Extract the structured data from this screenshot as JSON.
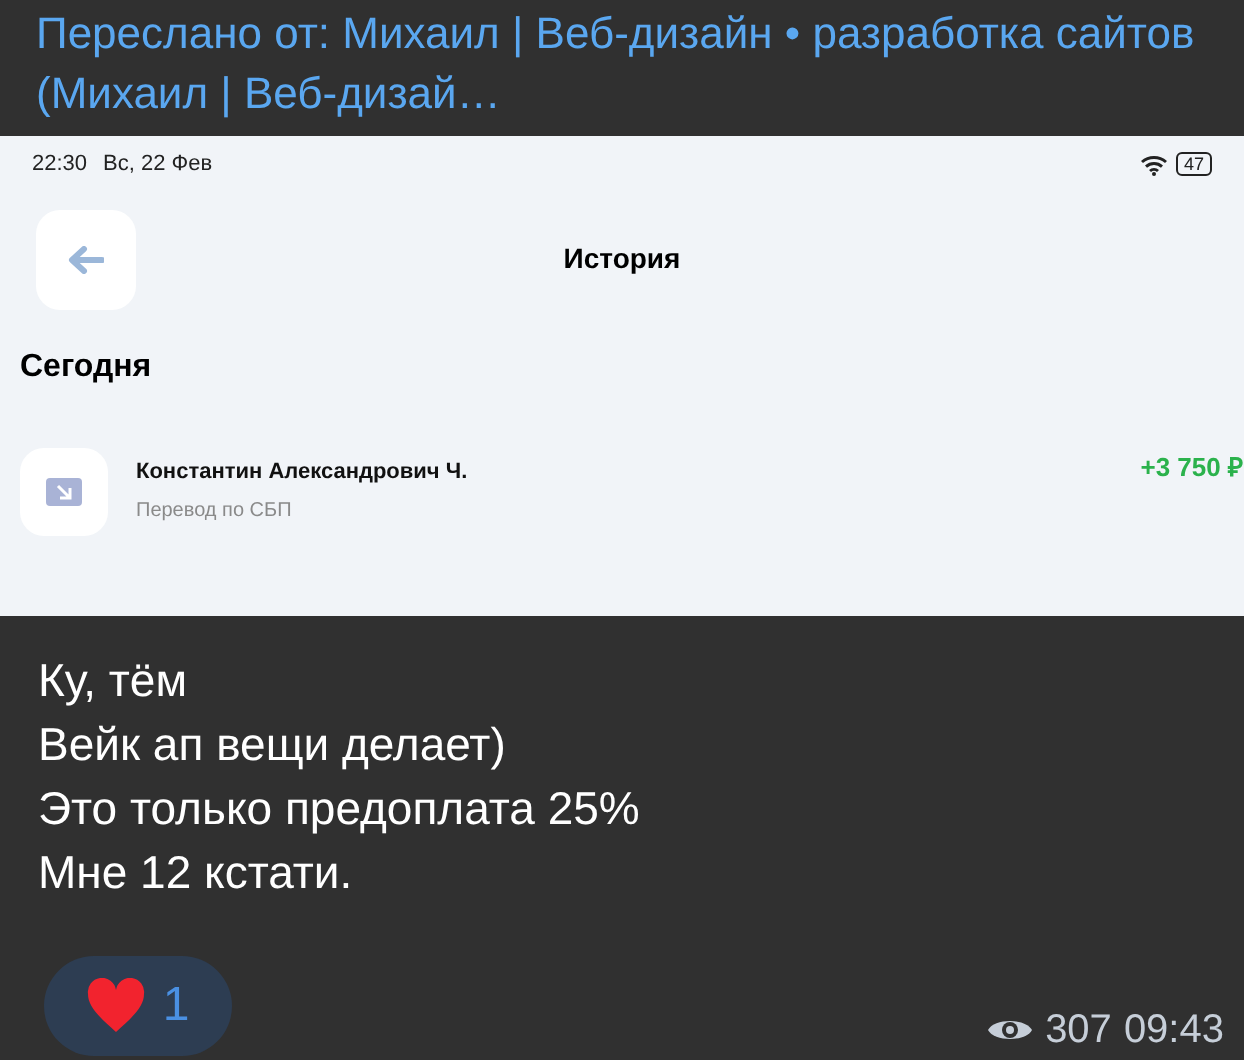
{
  "forwarded_from": {
    "label": "Переслано от: Михаил | Веб-дизайн • разработка сайтов (Михаил | Веб-дизай…"
  },
  "screenshot": {
    "status_bar": {
      "time": "22:30",
      "date": "Вс, 22 Фев",
      "battery": "47"
    },
    "title": "История",
    "section": "Сегодня",
    "transactions": [
      {
        "name": "Константин Александрович Ч.",
        "description": "Перевод по СБП",
        "amount": "+3 750 ₽"
      }
    ]
  },
  "message": {
    "lines": [
      "Ку, тём",
      "Вейк ап вещи делает)",
      "Это только предоплата 25%",
      "Мне 12 кстати."
    ]
  },
  "reactions": [
    {
      "count": "1"
    }
  ],
  "footer": {
    "views": "307",
    "time": "09:43"
  }
}
